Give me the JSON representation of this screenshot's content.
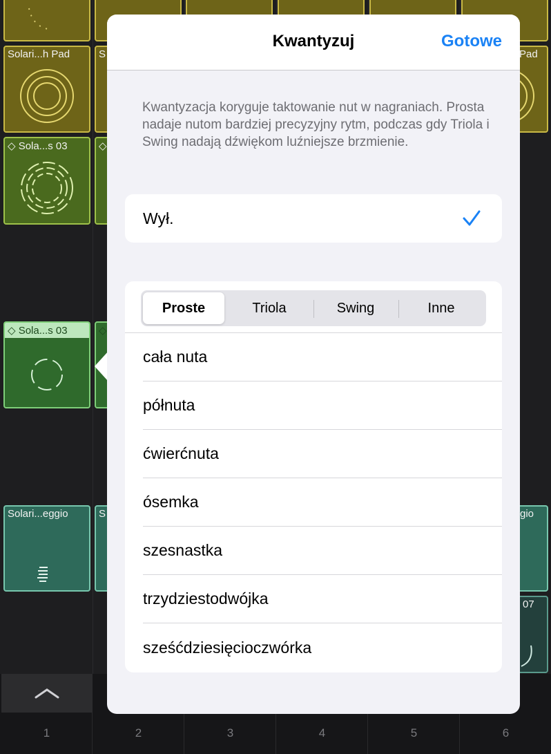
{
  "background": {
    "cells": [
      {
        "title": "Solari...h Pad"
      },
      {
        "title": "S"
      },
      {
        "title": "Pad"
      },
      {
        "title": "Sola...s 03"
      },
      {
        "title": "Sola...s 03"
      },
      {
        "title": "Solari...eggio"
      },
      {
        "title": "S"
      },
      {
        "title": "gio"
      },
      {
        "title": "07"
      }
    ],
    "columns": [
      "1",
      "2",
      "3",
      "4",
      "5",
      "6"
    ]
  },
  "popover": {
    "title": "Kwantyzuj",
    "done_label": "Gotowe",
    "description": "Kwantyzacja koryguje taktowanie nut w nagraniach. Prosta nadaje nutom bardziej precyzyjny rytm, podczas gdy Triola i Swing nadają dźwiękom luźniejsze brzmienie.",
    "off_option": {
      "label": "Wył.",
      "selected": true
    },
    "segments": [
      {
        "label": "Proste",
        "active": true
      },
      {
        "label": "Triola",
        "active": false
      },
      {
        "label": "Swing",
        "active": false
      },
      {
        "label": "Inne",
        "active": false
      }
    ],
    "items": [
      "cała nuta",
      "półnuta",
      "ćwierćnuta",
      "ósemka",
      "szesnastka",
      "trzydziestodwójka",
      "sześćdziesięcioczwórka"
    ],
    "accent_color": "#1a82f5"
  }
}
